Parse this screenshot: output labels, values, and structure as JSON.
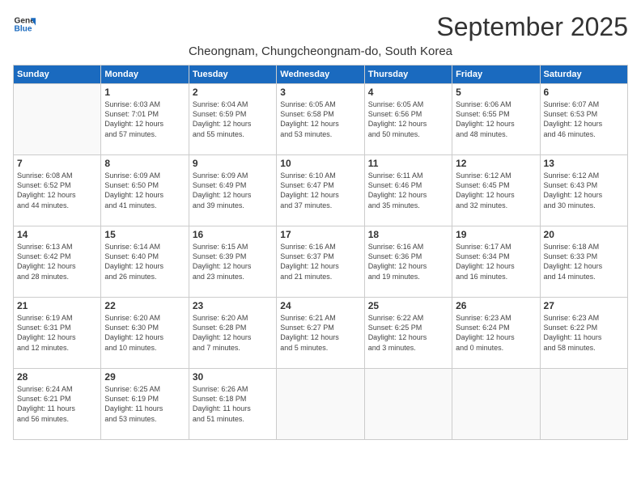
{
  "logo": {
    "line1": "General",
    "line2": "Blue"
  },
  "title": "September 2025",
  "location": "Cheongnam, Chungcheongnam-do, South Korea",
  "days_of_week": [
    "Sunday",
    "Monday",
    "Tuesday",
    "Wednesday",
    "Thursday",
    "Friday",
    "Saturday"
  ],
  "weeks": [
    [
      {
        "day": "",
        "info": ""
      },
      {
        "day": "1",
        "info": "Sunrise: 6:03 AM\nSunset: 7:01 PM\nDaylight: 12 hours\nand 57 minutes."
      },
      {
        "day": "2",
        "info": "Sunrise: 6:04 AM\nSunset: 6:59 PM\nDaylight: 12 hours\nand 55 minutes."
      },
      {
        "day": "3",
        "info": "Sunrise: 6:05 AM\nSunset: 6:58 PM\nDaylight: 12 hours\nand 53 minutes."
      },
      {
        "day": "4",
        "info": "Sunrise: 6:05 AM\nSunset: 6:56 PM\nDaylight: 12 hours\nand 50 minutes."
      },
      {
        "day": "5",
        "info": "Sunrise: 6:06 AM\nSunset: 6:55 PM\nDaylight: 12 hours\nand 48 minutes."
      },
      {
        "day": "6",
        "info": "Sunrise: 6:07 AM\nSunset: 6:53 PM\nDaylight: 12 hours\nand 46 minutes."
      }
    ],
    [
      {
        "day": "7",
        "info": "Sunrise: 6:08 AM\nSunset: 6:52 PM\nDaylight: 12 hours\nand 44 minutes."
      },
      {
        "day": "8",
        "info": "Sunrise: 6:09 AM\nSunset: 6:50 PM\nDaylight: 12 hours\nand 41 minutes."
      },
      {
        "day": "9",
        "info": "Sunrise: 6:09 AM\nSunset: 6:49 PM\nDaylight: 12 hours\nand 39 minutes."
      },
      {
        "day": "10",
        "info": "Sunrise: 6:10 AM\nSunset: 6:47 PM\nDaylight: 12 hours\nand 37 minutes."
      },
      {
        "day": "11",
        "info": "Sunrise: 6:11 AM\nSunset: 6:46 PM\nDaylight: 12 hours\nand 35 minutes."
      },
      {
        "day": "12",
        "info": "Sunrise: 6:12 AM\nSunset: 6:45 PM\nDaylight: 12 hours\nand 32 minutes."
      },
      {
        "day": "13",
        "info": "Sunrise: 6:12 AM\nSunset: 6:43 PM\nDaylight: 12 hours\nand 30 minutes."
      }
    ],
    [
      {
        "day": "14",
        "info": "Sunrise: 6:13 AM\nSunset: 6:42 PM\nDaylight: 12 hours\nand 28 minutes."
      },
      {
        "day": "15",
        "info": "Sunrise: 6:14 AM\nSunset: 6:40 PM\nDaylight: 12 hours\nand 26 minutes."
      },
      {
        "day": "16",
        "info": "Sunrise: 6:15 AM\nSunset: 6:39 PM\nDaylight: 12 hours\nand 23 minutes."
      },
      {
        "day": "17",
        "info": "Sunrise: 6:16 AM\nSunset: 6:37 PM\nDaylight: 12 hours\nand 21 minutes."
      },
      {
        "day": "18",
        "info": "Sunrise: 6:16 AM\nSunset: 6:36 PM\nDaylight: 12 hours\nand 19 minutes."
      },
      {
        "day": "19",
        "info": "Sunrise: 6:17 AM\nSunset: 6:34 PM\nDaylight: 12 hours\nand 16 minutes."
      },
      {
        "day": "20",
        "info": "Sunrise: 6:18 AM\nSunset: 6:33 PM\nDaylight: 12 hours\nand 14 minutes."
      }
    ],
    [
      {
        "day": "21",
        "info": "Sunrise: 6:19 AM\nSunset: 6:31 PM\nDaylight: 12 hours\nand 12 minutes."
      },
      {
        "day": "22",
        "info": "Sunrise: 6:20 AM\nSunset: 6:30 PM\nDaylight: 12 hours\nand 10 minutes."
      },
      {
        "day": "23",
        "info": "Sunrise: 6:20 AM\nSunset: 6:28 PM\nDaylight: 12 hours\nand 7 minutes."
      },
      {
        "day": "24",
        "info": "Sunrise: 6:21 AM\nSunset: 6:27 PM\nDaylight: 12 hours\nand 5 minutes."
      },
      {
        "day": "25",
        "info": "Sunrise: 6:22 AM\nSunset: 6:25 PM\nDaylight: 12 hours\nand 3 minutes."
      },
      {
        "day": "26",
        "info": "Sunrise: 6:23 AM\nSunset: 6:24 PM\nDaylight: 12 hours\nand 0 minutes."
      },
      {
        "day": "27",
        "info": "Sunrise: 6:23 AM\nSunset: 6:22 PM\nDaylight: 11 hours\nand 58 minutes."
      }
    ],
    [
      {
        "day": "28",
        "info": "Sunrise: 6:24 AM\nSunset: 6:21 PM\nDaylight: 11 hours\nand 56 minutes."
      },
      {
        "day": "29",
        "info": "Sunrise: 6:25 AM\nSunset: 6:19 PM\nDaylight: 11 hours\nand 53 minutes."
      },
      {
        "day": "30",
        "info": "Sunrise: 6:26 AM\nSunset: 6:18 PM\nDaylight: 11 hours\nand 51 minutes."
      },
      {
        "day": "",
        "info": ""
      },
      {
        "day": "",
        "info": ""
      },
      {
        "day": "",
        "info": ""
      },
      {
        "day": "",
        "info": ""
      }
    ]
  ]
}
